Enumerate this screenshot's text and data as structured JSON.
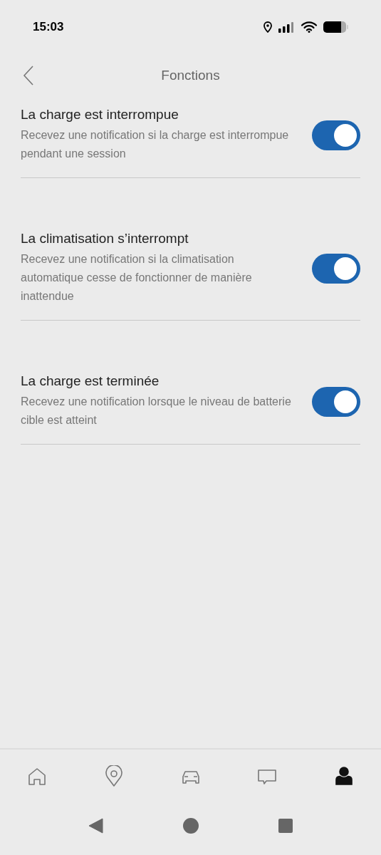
{
  "status_bar": {
    "time": "15:03"
  },
  "header": {
    "title": "Fonctions"
  },
  "settings": [
    {
      "title": "La charge est interrompue",
      "description": "Recevez une notification si la charge est interrompue pendant une session",
      "on": true
    },
    {
      "title": "La climatisation s’interrompt",
      "description": "Recevez une notification si la climatisation automatique cesse de fonctionner de manière inattendue",
      "on": true
    },
    {
      "title": "La charge est terminée",
      "description": "Recevez une notification lorsque le niveau de batterie cible est atteint",
      "on": true
    }
  ],
  "tab_bar": [
    {
      "kind": "home",
      "selected": false
    },
    {
      "kind": "map",
      "selected": false
    },
    {
      "kind": "car",
      "selected": false
    },
    {
      "kind": "chat",
      "selected": false
    },
    {
      "kind": "profile",
      "selected": true
    }
  ]
}
